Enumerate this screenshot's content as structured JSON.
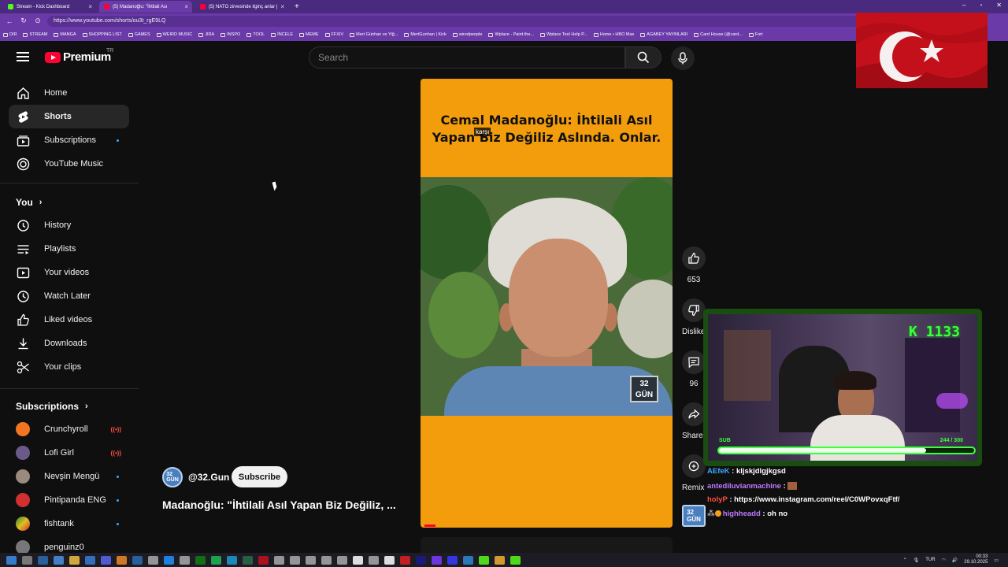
{
  "browser": {
    "tabs": [
      {
        "title": "Stream - Kick Dashboard",
        "color": "#53fc18",
        "active": false
      },
      {
        "title": "(5) Madanoğlu: \"İhtilali Ası",
        "color": "#ff0033",
        "active": true
      },
      {
        "title": "(5) NATO zirvesinde ilginç anlar |",
        "color": "#ff0033",
        "active": false
      }
    ],
    "url": "https://www.youtube.com/shorts/ou3t_rgE9LQ",
    "bookmarks": [
      "DIR",
      "STREAM",
      "MANGA",
      "SHOPPING LIST",
      "GAMES",
      "WEIRD MUSIC",
      "JIRA",
      "INSPO",
      "TOOL",
      "İNCELE",
      "MEME",
      "FFXIV",
      "Mert Günhan ve Yiğ...",
      "MertGunhan | Kick",
      "wiredpeople",
      "Wplace - Paint the...",
      "Wplace Tool Help P...",
      "Home • HBO Max",
      "AGABEY YAYINLARI",
      "Card House (@card...",
      "Fort"
    ]
  },
  "header": {
    "logo_text": "Premium",
    "logo_sup": "TR",
    "search_placeholder": "Search"
  },
  "sidebar": {
    "main": [
      {
        "label": "Home",
        "icon": "home-icon"
      },
      {
        "label": "Shorts",
        "icon": "shorts-icon",
        "active": true
      },
      {
        "label": "Subscriptions",
        "icon": "subscriptions-icon",
        "dot": true
      },
      {
        "label": "YouTube Music",
        "icon": "youtube-music-icon"
      }
    ],
    "you_heading": "You",
    "you": [
      {
        "label": "History",
        "icon": "history-icon"
      },
      {
        "label": "Playlists",
        "icon": "playlists-icon"
      },
      {
        "label": "Your videos",
        "icon": "your-videos-icon"
      },
      {
        "label": "Watch Later",
        "icon": "watch-later-icon"
      },
      {
        "label": "Liked videos",
        "icon": "liked-videos-icon"
      },
      {
        "label": "Downloads",
        "icon": "downloads-icon"
      },
      {
        "label": "Your clips",
        "icon": "clips-icon"
      }
    ],
    "subs_heading": "Subscriptions",
    "subs": [
      {
        "label": "Crunchyroll",
        "color": "#f47521",
        "status": "live"
      },
      {
        "label": "Lofi Girl",
        "color": "#6a5a8a",
        "status": "live"
      },
      {
        "label": "Nevşin Mengü",
        "color": "#9a8a80",
        "status": "dot"
      },
      {
        "label": "Pintipanda ENG",
        "color": "#d03030",
        "status": "dot"
      },
      {
        "label": "fishtank",
        "color": "#2a8a3a",
        "status": "dot"
      },
      {
        "label": "penguinz0",
        "color": "#777777",
        "status": ""
      }
    ]
  },
  "short": {
    "title": "Cemal Madanoğlu: İhtilali Asıl Yapan Biz Değiliz Aslında. Onlar.",
    "caption": "karşı",
    "watermark": "32\nGÜN",
    "channel_avatar": "32\nGÜN",
    "channel": "@32.Gun",
    "subscribe_label": "Subscribe",
    "video_title": "Madanoğlu: \"İhtilali Asıl Yapan Biz Değiliz, ..."
  },
  "actions": {
    "likes": "653",
    "dislike_label": "Dislike",
    "comments": "96",
    "share_label": "Share",
    "remix_label": "Remix"
  },
  "overlay": {
    "kick_count": "K 1133",
    "sub_label": "SUB",
    "sub_progress": "244 / 300",
    "sub_fraction": 0.813,
    "chat": [
      {
        "user": "AEfeK",
        "color": "#3ea6ff",
        "text": "kljskjdlgjkgsd"
      },
      {
        "user": "antediluvianmachine",
        "color": "#c07aff",
        "text": ""
      },
      {
        "user": "holyP",
        "color": "#ff4e45",
        "text": "https://www.instagram.com/reel/C0WPovxqFtf/"
      },
      {
        "user": "highheadd",
        "color": "#c07aff",
        "text": "oh no"
      }
    ]
  },
  "taskbar": {
    "lang": "TUR",
    "time": "00:33",
    "date": "29.10.2025"
  }
}
